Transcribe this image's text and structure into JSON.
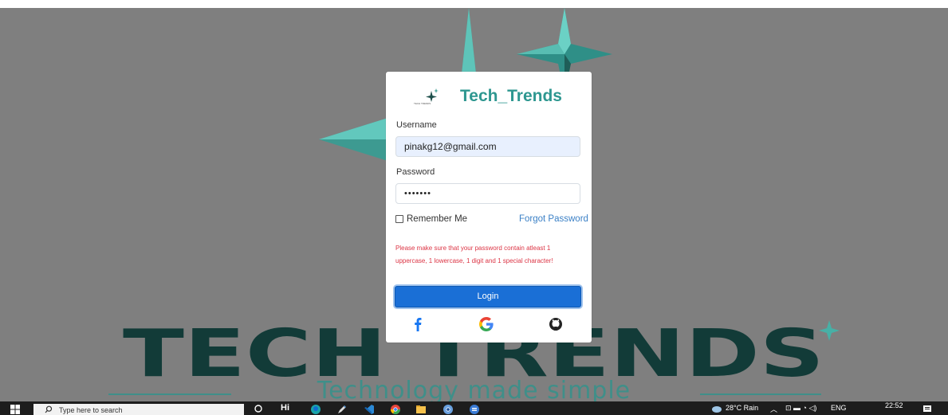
{
  "app": {
    "brand_name": "Tech_Trends",
    "logo_subtext": "TECH TRENDS"
  },
  "background": {
    "big_text": "TECH TRENDS",
    "tagline": "Technology made simple"
  },
  "login": {
    "username_label": "Username",
    "username_value": "pinakg12@gmail.com",
    "password_label": "Password",
    "password_masked": "•••••••",
    "remember_label": "Remember Me",
    "remember_checked": false,
    "forgot_label": "Forgot Password",
    "error_message": "Please make sure that your password contain atleast 1 uppercase, 1 lowercase, 1 digit and 1 special character!",
    "login_button": "Login",
    "social_icons": [
      "facebook-icon",
      "google-icon",
      "github-icon"
    ]
  },
  "taskbar": {
    "search_placeholder": "Type here to search",
    "weather": "28°C Rain",
    "language": "ENG",
    "time": "22:52",
    "icons": [
      "windows-start-icon",
      "cortana-icon",
      "hi-icon",
      "edge-icon",
      "pen-icon",
      "vscode-icon",
      "chrome-icon",
      "file-explorer-icon",
      "chrome-dev-icon",
      "edge-blue-icon"
    ]
  },
  "colors": {
    "brand_teal": "#2e9790",
    "primary_button": "#1a6fd6",
    "error_red": "#dc3545",
    "link_blue": "#3b80c6",
    "background_gray": "#7f7f7f"
  }
}
